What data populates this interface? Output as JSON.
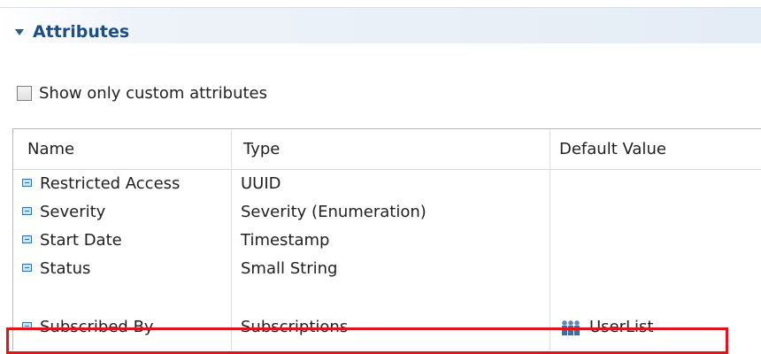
{
  "section": {
    "title": "Attributes",
    "toggle_icon": "triangle-down-icon"
  },
  "filter": {
    "checkbox_label": "Show only custom attributes",
    "checked": false
  },
  "table": {
    "columns": [
      "Name",
      "Type",
      "Default Value"
    ],
    "rows": [
      {
        "name": "Restricted Access",
        "type": "UUID",
        "default": ""
      },
      {
        "name": "Severity",
        "type": "Severity (Enumeration)",
        "default": ""
      },
      {
        "name": "Start Date",
        "type": "Timestamp",
        "default": ""
      },
      {
        "name": "Status",
        "type": "Small String",
        "default": ""
      },
      {
        "name": "Subscribed By",
        "type": "Subscriptions",
        "default": "UserList",
        "default_icon": "users-icon"
      }
    ]
  },
  "colors": {
    "header_text": "#1f4f82",
    "highlight_border": "#e3121d",
    "attribute_icon": "#2a73b8"
  }
}
